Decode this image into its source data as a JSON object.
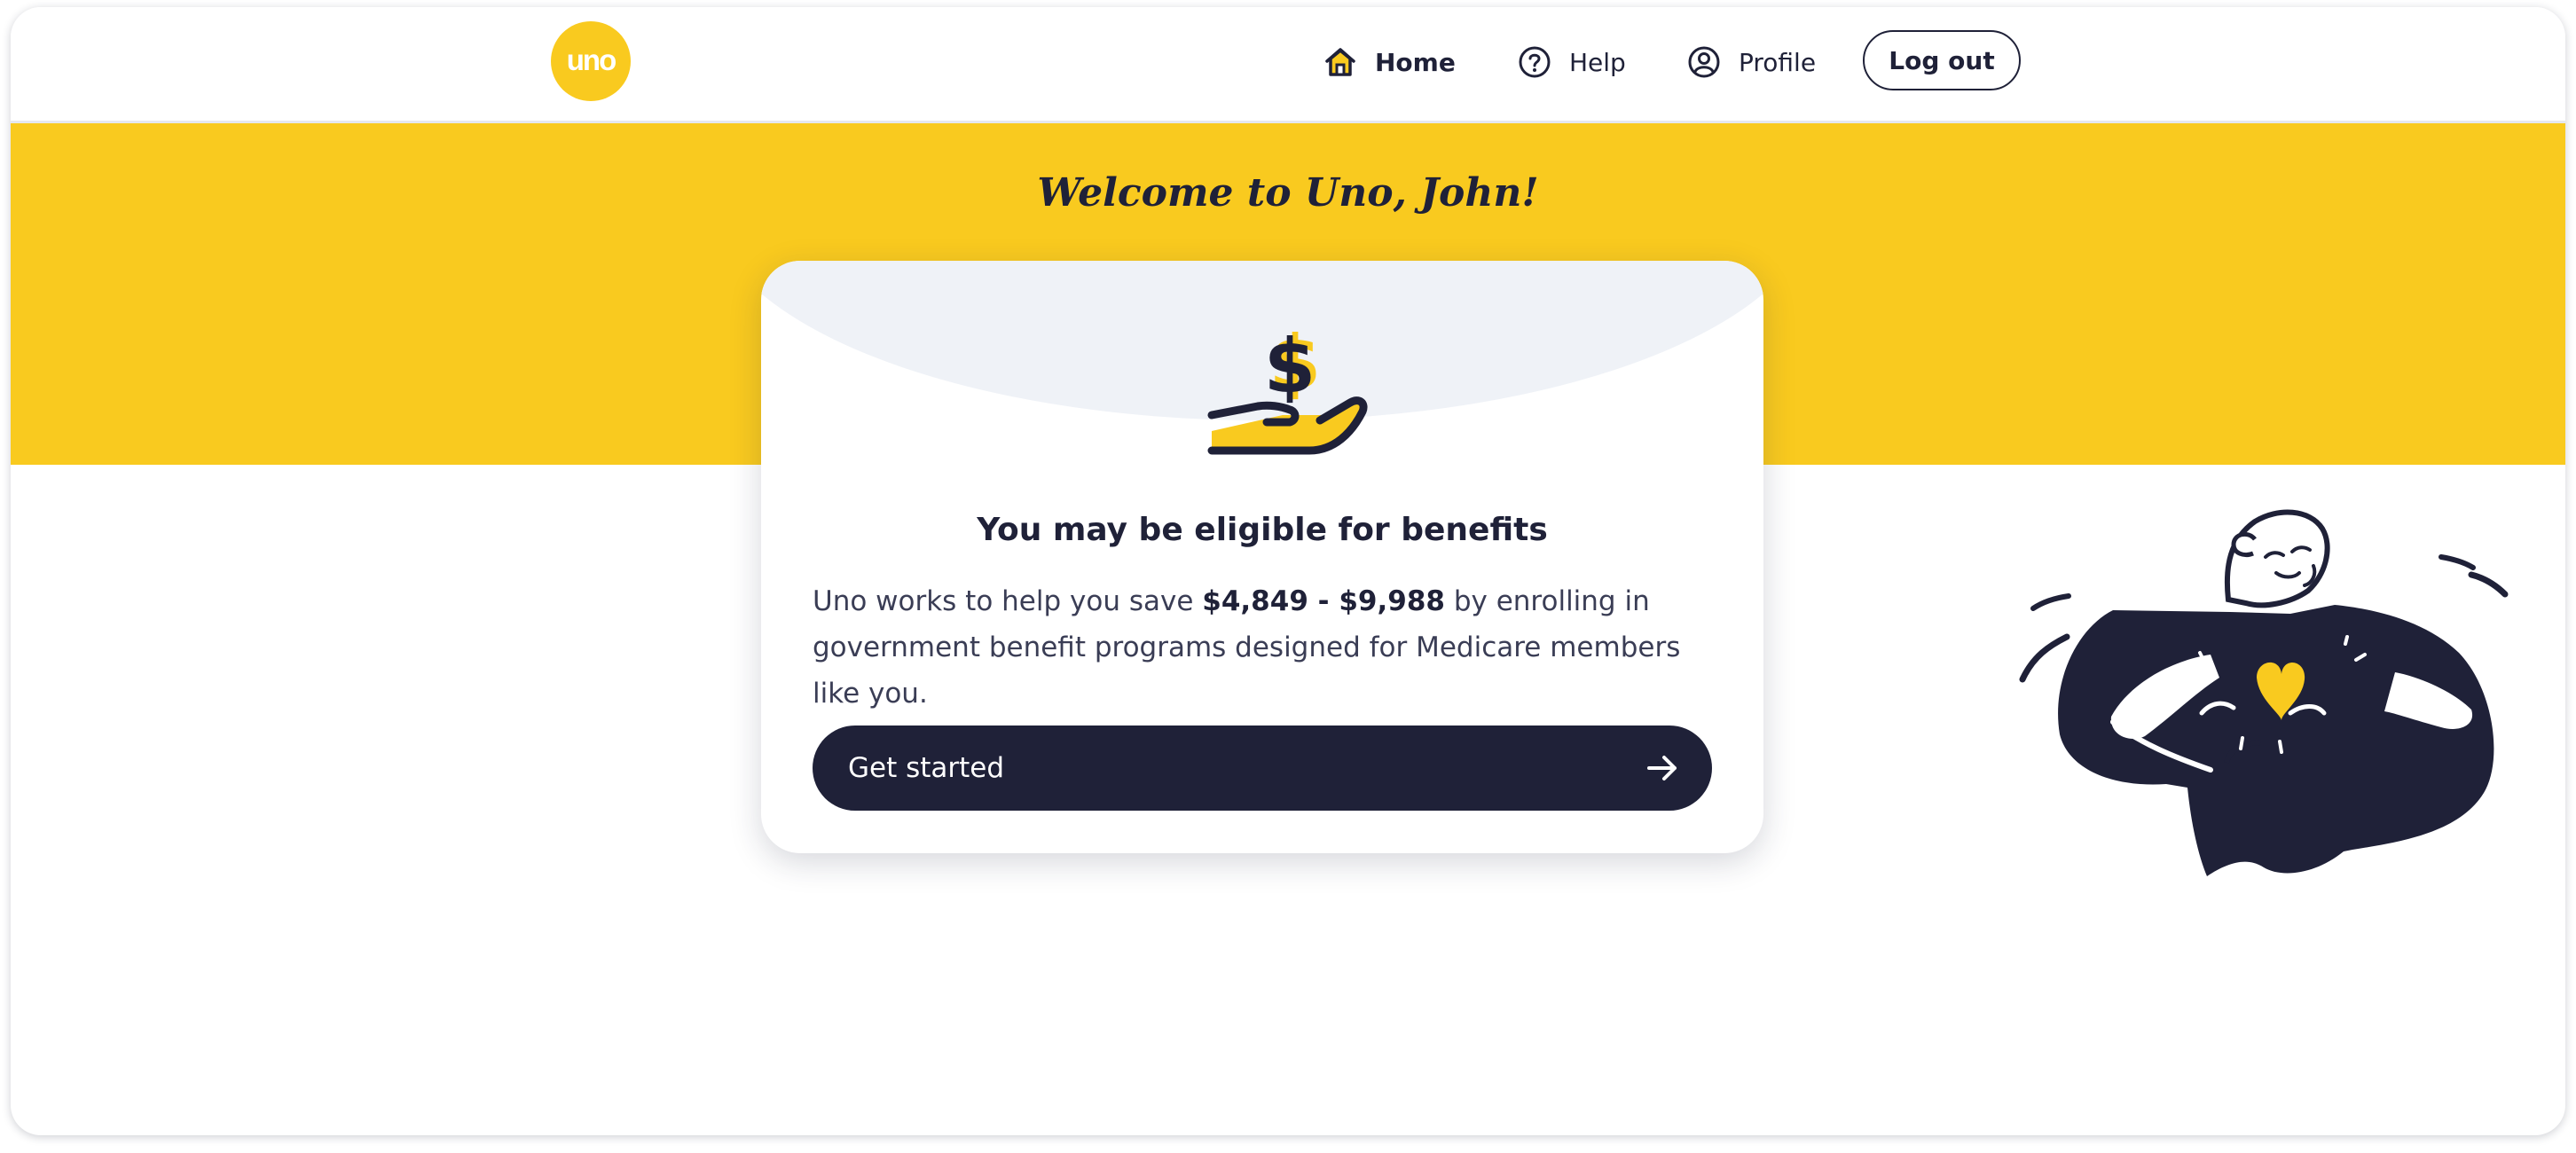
{
  "brand": {
    "logo_text": "uno",
    "color": "#f9ca1f"
  },
  "nav": {
    "home": {
      "label": "Home",
      "icon": "home-icon",
      "active": true
    },
    "help": {
      "label": "Help",
      "icon": "help-icon"
    },
    "profile": {
      "label": "Profile",
      "icon": "profile-icon"
    },
    "logout_label": "Log out"
  },
  "welcome": "Welcome to Uno, John!",
  "card": {
    "icon": "hand-dollar-icon",
    "title": "You may be eligible for benefits",
    "body_prefix": "Uno works to help you save ",
    "savings_range": "$4,849 - $9,988",
    "body_suffix": " by enrolling in government benefit programs designed for Medicare members like you.",
    "cta_label": "Get started",
    "cta_icon": "arrow-right-icon"
  },
  "illustration": "person-heart-illustration",
  "colors": {
    "accent": "#f9ca1f",
    "navy": "#1f2138",
    "card_tint": "#eff2f7"
  }
}
